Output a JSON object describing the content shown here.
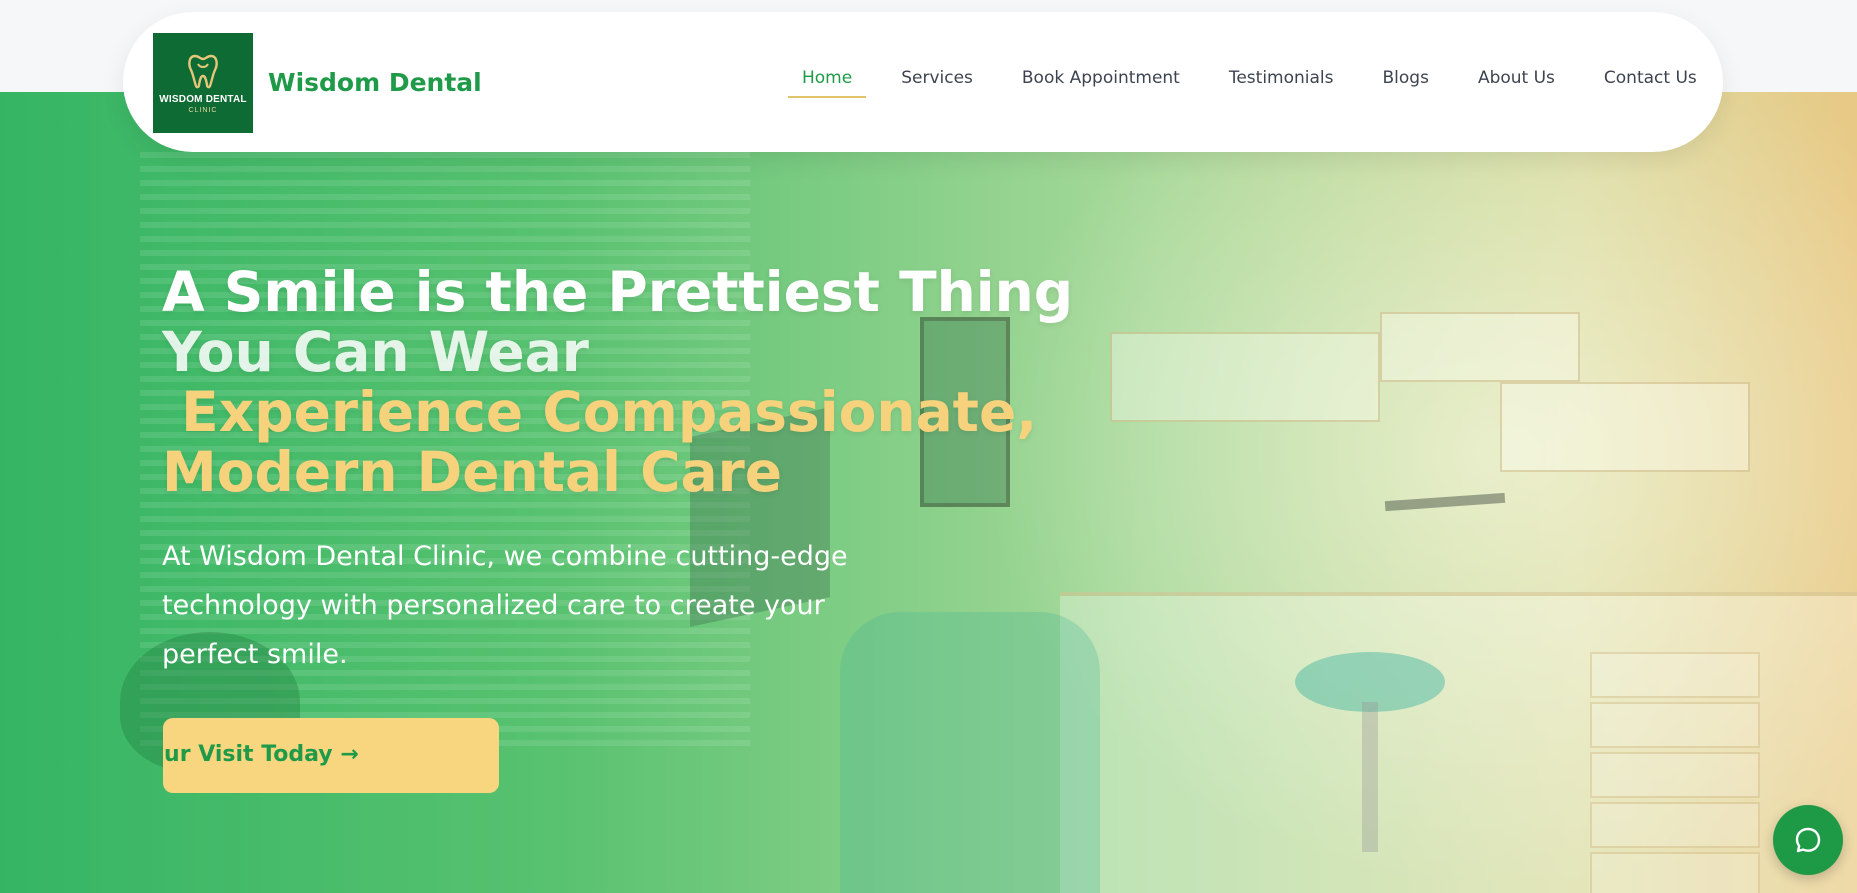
{
  "brand": {
    "logo_line1": "WISDOM DENTAL",
    "logo_line2": "CLINIC",
    "name": "Wisdom Dental"
  },
  "nav": {
    "items": [
      {
        "label": "Home",
        "active": true
      },
      {
        "label": "Services",
        "active": false
      },
      {
        "label": "Book Appointment",
        "active": false
      },
      {
        "label": "Testimonials",
        "active": false
      },
      {
        "label": "Blogs",
        "active": false
      },
      {
        "label": "About Us",
        "active": false
      },
      {
        "label": "Contact Us",
        "active": false
      }
    ]
  },
  "hero": {
    "title_line1": "A Smile is the Prettiest Thing",
    "title_line2": "You Can Wear",
    "title_line3": " Experience Compassionate,",
    "title_line4": "Modern Dental Care",
    "description": "At Wisdom Dental Clinic, we combine cutting-edge technology with personalized care to create your perfect smile.",
    "cta_label": "Your Visit Today →"
  },
  "chat": {
    "icon": "chat-bubble-icon"
  },
  "colors": {
    "brand_green": "#1f9a48",
    "logo_green": "#0e6b34",
    "gold": "#f6d27c",
    "cta_bg": "#f8d67f",
    "nav_text": "#3d4451"
  }
}
